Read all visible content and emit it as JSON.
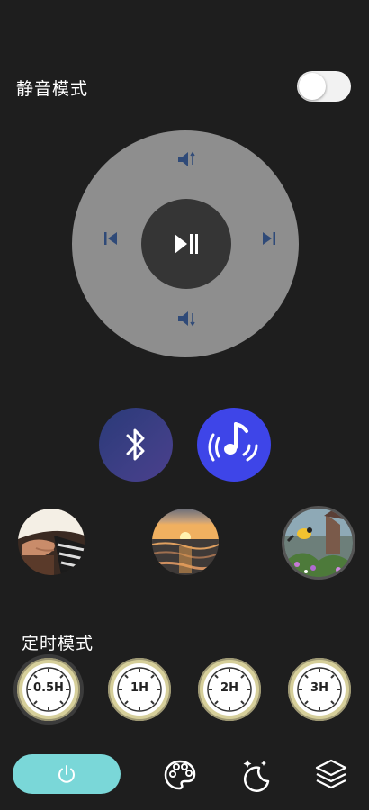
{
  "mute": {
    "label": "静音模式",
    "enabled": false
  },
  "remote": {
    "volume_up_icon": "volume-up-icon",
    "volume_down_icon": "volume-down-icon",
    "prev_icon": "previous-track-icon",
    "next_icon": "next-track-icon",
    "play_pause_icon": "play-pause-icon"
  },
  "buttons": {
    "bluetooth_icon": "bluetooth-icon",
    "music_icon": "music-note-icon"
  },
  "scenes": [
    {
      "name": "piano"
    },
    {
      "name": "sunset-sea"
    },
    {
      "name": "birds"
    }
  ],
  "timer": {
    "label": "定时模式",
    "options": [
      "0.5H",
      "1H",
      "2H",
      "3H"
    ],
    "selected": "0.5H"
  },
  "bottom_bar": {
    "power_icon": "power-icon",
    "palette_icon": "palette-icon",
    "moon_icon": "moon-stars-icon",
    "layers_icon": "layers-icon"
  },
  "colors": {
    "background": "#1e1e1e",
    "dpad": "#8e8e8e",
    "accent_blue": "#3e45e8",
    "power_teal": "#7ad7d8",
    "timer_ring": "#d6cf9a"
  }
}
